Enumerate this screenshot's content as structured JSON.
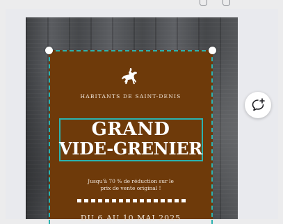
{
  "poster": {
    "organization": "HABITANTS DE SAINT-DENIS",
    "title_line1": "GRAND",
    "title_line2": "VIDE-GRENIER",
    "description_line1": "Jusqu'à 70 % de réduction sur le",
    "description_line2": "prix de vente original !",
    "dates": "DU 6 AU 10 MAI 2025"
  },
  "icons": {
    "logo": "horse-rider-icon",
    "comment": "add-comment-icon"
  },
  "colors": {
    "panel": "#6e3a0a",
    "selection": "#2bb3b0",
    "canvas_bg": "#e9eaee"
  }
}
